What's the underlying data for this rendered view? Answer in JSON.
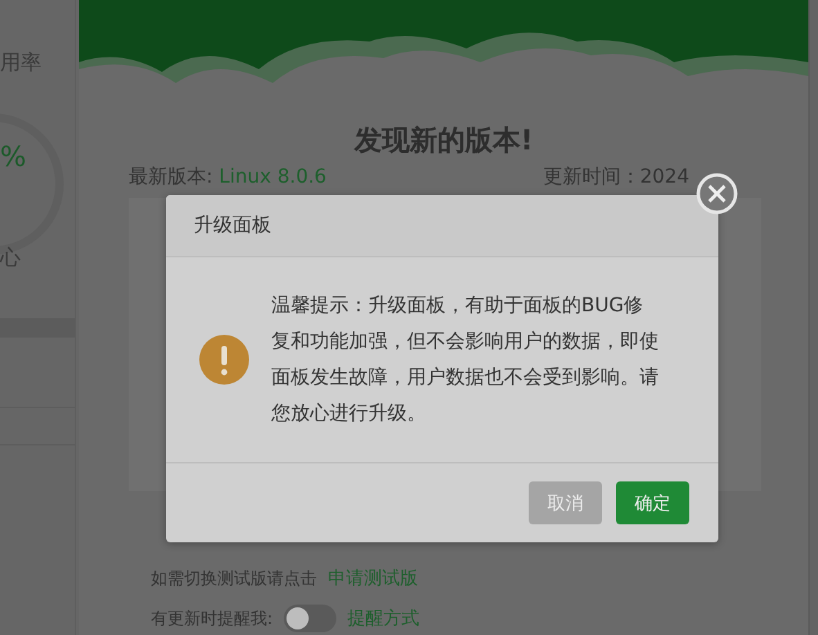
{
  "sidebar": {
    "items": [
      {
        "text": "用率",
        "kind": "label"
      },
      {
        "text": "%",
        "kind": "value"
      },
      {
        "text": "心",
        "kind": "label"
      }
    ]
  },
  "update_panel": {
    "title": "发现新的版本!",
    "version_label": "最新版本:",
    "version": "Linux 8.0.6",
    "update_time": "更新时间：2024",
    "beta_hint": "如需切换测试版请点击",
    "beta_link": "申请测试版",
    "reminder": {
      "label": "有更新时提醒我:",
      "on": false,
      "link": "提醒方式"
    }
  },
  "dialog": {
    "title": "升级面板",
    "message": "温馨提示：升级面板，有助于面板的BUG修复和功能加强，但不会影响用户的数据，即使面板发生故障，用户数据也不会受到影响。请您放心进行升级。",
    "buttons": [
      {
        "label": "取消",
        "disabled": true
      },
      {
        "label": "确定",
        "disabled": false
      }
    ]
  }
}
